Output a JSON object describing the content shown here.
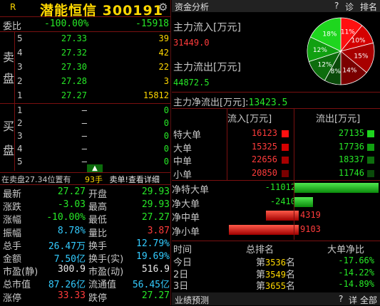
{
  "header": {
    "mark": "R",
    "stock_name": "潜能恒信",
    "stock_code": "300191",
    "gear_icon": "gear-icon"
  },
  "wb": {
    "label": "委比",
    "pct": "-100.00%",
    "diff": "-15918"
  },
  "sell_label": [
    "卖",
    "盘"
  ],
  "buy_label": [
    "买",
    "盘"
  ],
  "asks": [
    {
      "lvl": "5",
      "price": "27.33",
      "vol": "39"
    },
    {
      "lvl": "4",
      "price": "27.32",
      "vol": "42"
    },
    {
      "lvl": "3",
      "price": "27.30",
      "vol": "22"
    },
    {
      "lvl": "2",
      "price": "27.28",
      "vol": "3"
    },
    {
      "lvl": "1",
      "price": "27.27",
      "vol": "15812"
    }
  ],
  "bids": [
    {
      "lvl": "1",
      "price": "–",
      "vol": "0"
    },
    {
      "lvl": "2",
      "price": "–",
      "vol": "0"
    },
    {
      "lvl": "3",
      "price": "–",
      "vol": "0"
    },
    {
      "lvl": "4",
      "price": "–",
      "vol": "0"
    },
    {
      "lvl": "5",
      "price": "–",
      "vol": "0"
    }
  ],
  "notice": {
    "prefix": "在卖盘27.34位置有",
    "qty": "93手",
    "suffix": "卖单!查看详细"
  },
  "stats": [
    {
      "l1": "最新",
      "v1": "27.27",
      "c1": "green",
      "l2": "开盘",
      "v2": "29.93",
      "c2": "green"
    },
    {
      "l1": "涨跌",
      "v1": "-3.03",
      "c1": "green",
      "l2": "最高",
      "v2": "29.93",
      "c2": "green"
    },
    {
      "l1": "涨幅",
      "v1": "-10.00%",
      "c1": "green",
      "l2": "最低",
      "v2": "27.27",
      "c2": "green"
    },
    {
      "l1": "振幅",
      "v1": "8.78%",
      "c1": "cyan",
      "l2": "量比",
      "v2": "3.87",
      "c2": "red"
    },
    {
      "l1": "总手",
      "v1": "26.47万",
      "c1": "cyan",
      "l2": "换手",
      "v2": "12.79%",
      "c2": "cyan"
    },
    {
      "l1": "金额",
      "v1": "7.50亿",
      "c1": "cyan",
      "l2": "换手(实)",
      "v2": "19.69%",
      "c2": "cyan"
    },
    {
      "l1": "市盈(静)",
      "v1": "300.9",
      "c1": "white",
      "l2": "市盈(动)",
      "v2": "516.9",
      "c2": "white"
    },
    {
      "l1": "总市值",
      "v1": "87.26亿",
      "c1": "cyan",
      "l2": "流通值",
      "v2": "56.45亿",
      "c2": "cyan"
    },
    {
      "l1": "涨停",
      "v1": "33.33",
      "c1": "red",
      "l2": "跌停",
      "v2": "27.27",
      "c2": "green"
    }
  ],
  "fund": {
    "title": "资金分析",
    "btn_help": "?",
    "btn_diag": "诊",
    "btn_rank": "排名",
    "inflow_label": "主力流入[万元]",
    "inflow_value": "31449.0",
    "outflow_label": "主力流出[万元]",
    "outflow_value": "44872.5",
    "net_label": "主力净流出[万元]:",
    "net_value": "13423.5",
    "col_in": "流入[万元]",
    "col_out": "流出[万元]",
    "rows": [
      {
        "name": "特大单",
        "in": "16123",
        "out": "27135"
      },
      {
        "name": "大单",
        "in": "15325",
        "out": "17736"
      },
      {
        "name": "中单",
        "in": "22656",
        "out": "18337"
      },
      {
        "name": "小单",
        "in": "20850",
        "out": "11746"
      }
    ],
    "net_rows": [
      {
        "name": "净特大单",
        "value": "-11012",
        "frac": 1.0,
        "dir": "neg"
      },
      {
        "name": "净大单",
        "value": "-2410",
        "frac": 0.219,
        "dir": "neg"
      },
      {
        "name": "净中单",
        "value": "4319",
        "frac": 0.392,
        "dir": "pos"
      },
      {
        "name": "净小单",
        "value": "9103",
        "frac": 0.827,
        "dir": "pos"
      }
    ],
    "rank_cols": [
      "时间",
      "总排名",
      "大单净比"
    ],
    "rank_rows": [
      {
        "time": "今日",
        "pre": "第",
        "rank": "3536",
        "suf": "名",
        "ratio": "-17.66%"
      },
      {
        "time": "2日",
        "pre": "第",
        "rank": "3549",
        "suf": "名",
        "ratio": "-14.22%"
      },
      {
        "time": "3日",
        "pre": "第",
        "rank": "3655",
        "suf": "名",
        "ratio": "-14.89%"
      }
    ],
    "pie": [
      {
        "label": "11%",
        "value": 11,
        "color": "#ff1010"
      },
      {
        "label": "10%",
        "value": 10,
        "color": "#d40000"
      },
      {
        "label": "15%",
        "value": 15,
        "color": "#a80000"
      },
      {
        "label": "14%",
        "value": 14,
        "color": "#7a0000"
      },
      {
        "label": "8%",
        "value": 8,
        "color": "#0a4a0a"
      },
      {
        "label": "12%",
        "value": 12,
        "color": "#0d6d0d"
      },
      {
        "label": "12%",
        "value": 12,
        "color": "#11a011"
      },
      {
        "label": "18%",
        "value": 18,
        "color": "#1ed61e"
      }
    ]
  },
  "bottom": {
    "label": "业绩预测",
    "help": "?",
    "detail": "详",
    "all": "全部"
  }
}
